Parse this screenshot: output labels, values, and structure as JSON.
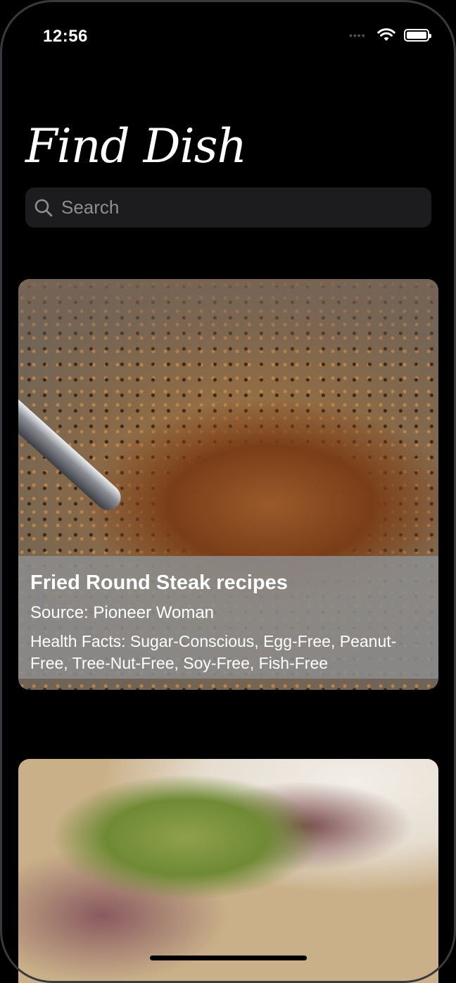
{
  "status_bar": {
    "time": "12:56"
  },
  "header": {
    "title": "Find Dish"
  },
  "search": {
    "placeholder": "Search"
  },
  "recipes": [
    {
      "title": "Fried Round Steak recipes",
      "source": "Source: Pioneer Woman",
      "health": "Health Facts: Sugar-Conscious, Egg-Free, Peanut-Free, Tree-Nut-Free, Soy-Free, Fish-Free"
    },
    {
      "title": "",
      "source": "",
      "health": ""
    }
  ],
  "colors": {
    "background": "#000000",
    "search_bg": "#1c1c1e",
    "placeholder": "#8d8d93",
    "card_overlay": "#8c8c8c"
  },
  "icons": [
    "search-icon",
    "wifi-icon",
    "battery-icon"
  ]
}
